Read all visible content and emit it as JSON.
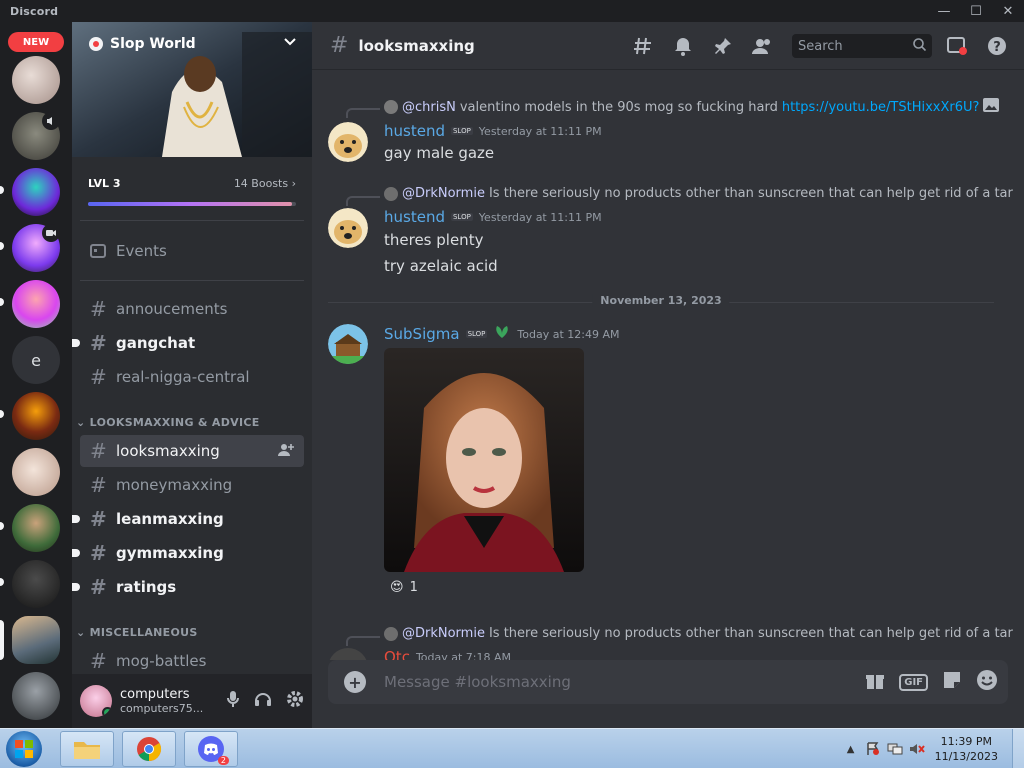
{
  "window": {
    "title": "Discord",
    "minimize": "—",
    "maximize": "☐",
    "close": "✕"
  },
  "rail": {
    "new_label": "NEW",
    "text_server_letter": "e"
  },
  "server": {
    "name": "Slop World"
  },
  "boost": {
    "level": "LVL 3",
    "count": "14 Boosts",
    "progress": 0.98
  },
  "nav": {
    "events": "Events"
  },
  "channels_top": [
    {
      "name": "annoucements",
      "unread": false
    },
    {
      "name": "gangchat",
      "unread": true
    },
    {
      "name": "real-nigga-central",
      "unread": false
    }
  ],
  "category_looks": "LOOKSMAXXING & ADVICE",
  "channels_looks": [
    {
      "name": "looksmaxxing",
      "active": true,
      "unread": false
    },
    {
      "name": "moneymaxxing",
      "active": false,
      "unread": false
    },
    {
      "name": "leanmaxxing",
      "active": false,
      "unread": true
    },
    {
      "name": "gymmaxxing",
      "active": false,
      "unread": true
    },
    {
      "name": "ratings",
      "active": false,
      "unread": true
    }
  ],
  "category_misc": "MISCELLANEOUS",
  "channels_misc": [
    {
      "name": "mog-battles",
      "unread": false
    }
  ],
  "user": {
    "name": "computers",
    "tag": "computers75..."
  },
  "header": {
    "channel": "looksmaxxing",
    "search_placeholder": "Search"
  },
  "messages": [
    {
      "reply_mention": "@chrisN",
      "reply_text": "valentino models in the 90s mog so fucking hard",
      "reply_link": "https://youtu.be/TStHixxXr6U?",
      "author": "hustend",
      "badge": "SLOP",
      "time": "Yesterday at 11:11 PM",
      "lines": [
        "gay male gaze"
      ]
    },
    {
      "reply_mention": "@DrkNormie",
      "reply_text": "Is there seriously no products other than sunscreen that can help get rid of a tar",
      "author": "hustend",
      "badge": "SLOP",
      "time": "Yesterday at 11:11 PM",
      "lines": [
        "theres plenty",
        "try azelaic acid"
      ]
    }
  ],
  "date_divider": "November 13, 2023",
  "image_message": {
    "author": "SubSigma",
    "badge": "SLOP",
    "time": "Today at 12:49 AM",
    "reaction_emoji": "😍",
    "reaction_count": "1"
  },
  "next_message": {
    "reply_mention": "@DrkNormie",
    "reply_text": "Is there seriously no products other than sunscreen that can help get rid of a tar",
    "author": "Otc",
    "time": "Today at 7:18 AM"
  },
  "composer": {
    "placeholder": "Message #looksmaxxing",
    "gif_label": "GIF"
  },
  "taskbar": {
    "time": "11:39 PM",
    "date": "11/13/2023",
    "discord_badge": "2"
  },
  "colors": {
    "accent": "#5865f2",
    "danger": "#f23f42",
    "link": "#00a8fc",
    "author": "#5aa9e6"
  }
}
